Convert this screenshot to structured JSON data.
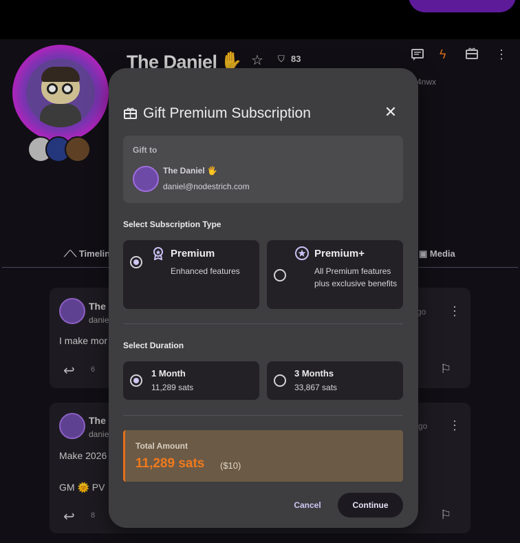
{
  "background": {
    "profile": {
      "name": "The Daniel",
      "name_emoji": "✋",
      "trust_score": "83",
      "npub_tail": "4nwx"
    },
    "tabs": [
      {
        "label": "Timelin",
        "icon": "timeline-icon"
      },
      {
        "label": "Media",
        "icon": "media-icon"
      }
    ],
    "posts": [
      {
        "name": "The",
        "handle": "danie",
        "text": "I make mor",
        "ago": "r ago",
        "reply_count": "6"
      },
      {
        "name": "The",
        "handle": "danie",
        "text": "Make 2026",
        "text2": "GM 🌞 PV",
        "ago": "s ago",
        "reply_count": "8"
      }
    ]
  },
  "modal": {
    "title": "Gift Premium Subscription",
    "gift_to": {
      "label": "Gift to",
      "name": "The Daniel 🖐",
      "email": "daniel@nodestrich.com"
    },
    "subscription_type": {
      "label": "Select Subscription Type",
      "options": [
        {
          "title": "Premium",
          "desc": "Enhanced features",
          "selected": true,
          "icon": "badge-icon"
        },
        {
          "title": "Premium+",
          "desc": "All Premium features plus exclusive benefits",
          "selected": false,
          "icon": "star-badge-icon"
        }
      ]
    },
    "duration": {
      "label": "Select Duration",
      "options": [
        {
          "title": "1 Month",
          "price": "11,289 sats",
          "selected": true
        },
        {
          "title": "3 Months",
          "price": "33,867 sats",
          "selected": false
        }
      ]
    },
    "total": {
      "label": "Total Amount",
      "amount": "11,289 sats",
      "usd": "($10)"
    },
    "actions": {
      "cancel": "Cancel",
      "continue": "Continue"
    }
  },
  "colors": {
    "accent": "#cfc8f4",
    "orange": "#f07a1e",
    "modal_bg": "#3e3d40"
  }
}
